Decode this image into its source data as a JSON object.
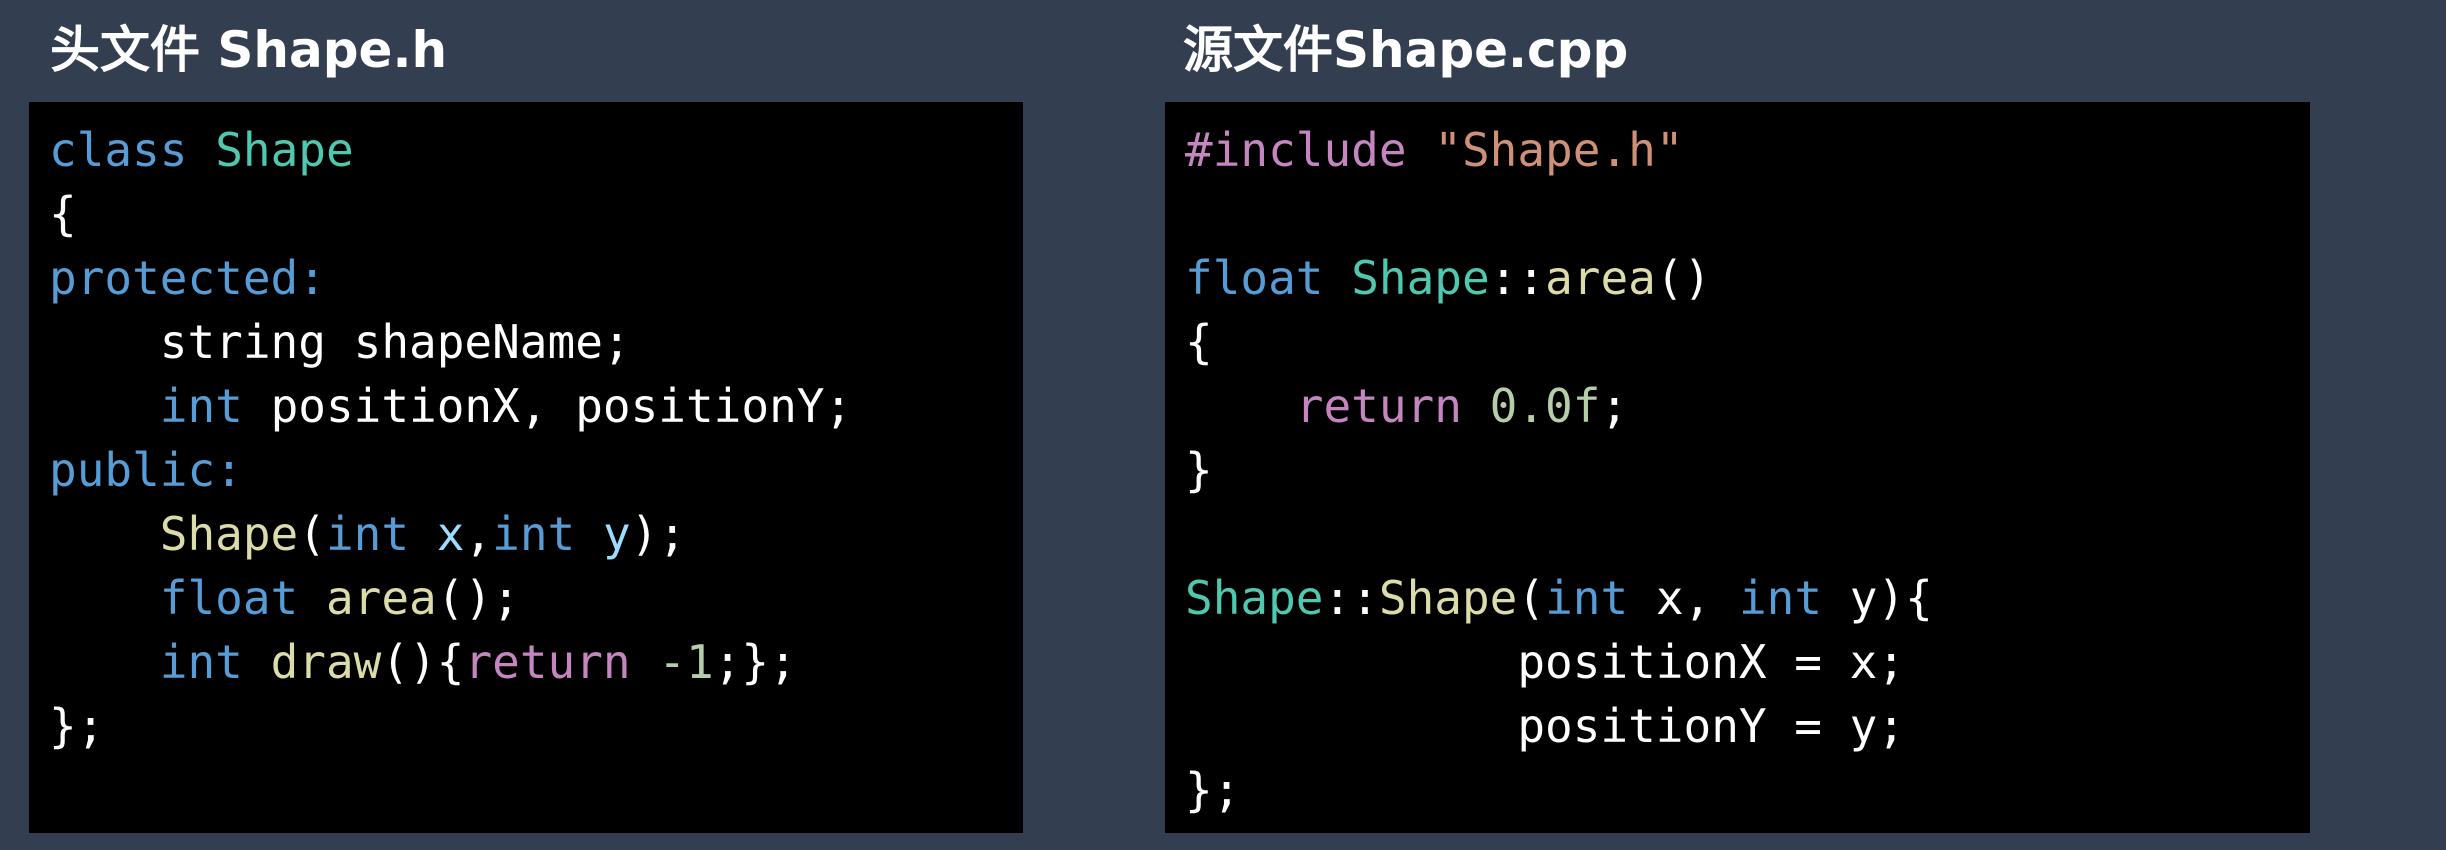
{
  "panels": [
    {
      "title": "头文件 Shape.h",
      "lines": [
        [
          [
            "kw",
            "class"
          ],
          [
            "pl",
            " "
          ],
          [
            "ty",
            "Shape"
          ]
        ],
        [
          [
            "pl",
            "{"
          ]
        ],
        [
          [
            "kw",
            "protected:"
          ]
        ],
        [
          [
            "pl",
            "    string shapeName;"
          ]
        ],
        [
          [
            "pl",
            "    "
          ],
          [
            "kw",
            "int"
          ],
          [
            "pl",
            " positionX, positionY;"
          ]
        ],
        [
          [
            "kw",
            "public:"
          ]
        ],
        [
          [
            "pl",
            "    "
          ],
          [
            "fn",
            "Shape"
          ],
          [
            "pl",
            "("
          ],
          [
            "kw",
            "int"
          ],
          [
            "pl",
            " "
          ],
          [
            "var",
            "x"
          ],
          [
            "pl",
            ","
          ],
          [
            "kw",
            "int"
          ],
          [
            "pl",
            " "
          ],
          [
            "var",
            "y"
          ],
          [
            "pl",
            ");"
          ]
        ],
        [
          [
            "pl",
            "    "
          ],
          [
            "kw",
            "float"
          ],
          [
            "pl",
            " "
          ],
          [
            "fn",
            "area"
          ],
          [
            "pl",
            "();"
          ]
        ],
        [
          [
            "pl",
            "    "
          ],
          [
            "kw",
            "int"
          ],
          [
            "pl",
            " "
          ],
          [
            "fn",
            "draw"
          ],
          [
            "pl",
            "(){"
          ],
          [
            "ct",
            "return"
          ],
          [
            "pl",
            " "
          ],
          [
            "num",
            "-1"
          ],
          [
            "pl",
            ";};"
          ]
        ],
        [
          [
            "pl",
            "};"
          ]
        ]
      ]
    },
    {
      "title": "源文件Shape.cpp",
      "lines": [
        [
          [
            "ct",
            "#include"
          ],
          [
            "pl",
            " "
          ],
          [
            "str",
            "\"Shape.h\""
          ]
        ],
        [
          [
            "pl",
            ""
          ]
        ],
        [
          [
            "kw",
            "float"
          ],
          [
            "pl",
            " "
          ],
          [
            "ty",
            "Shape"
          ],
          [
            "pl",
            "::"
          ],
          [
            "fn",
            "area"
          ],
          [
            "pl",
            "()"
          ]
        ],
        [
          [
            "pl",
            "{"
          ]
        ],
        [
          [
            "pl",
            "    "
          ],
          [
            "ct",
            "return"
          ],
          [
            "pl",
            " "
          ],
          [
            "num",
            "0.0f"
          ],
          [
            "pl",
            ";"
          ]
        ],
        [
          [
            "pl",
            "}"
          ]
        ],
        [
          [
            "pl",
            ""
          ]
        ],
        [
          [
            "ty",
            "Shape"
          ],
          [
            "pl",
            "::"
          ],
          [
            "fn",
            "Shape"
          ],
          [
            "pl",
            "("
          ],
          [
            "kw",
            "int"
          ],
          [
            "pl",
            " x, "
          ],
          [
            "kw",
            "int"
          ],
          [
            "pl",
            " y){"
          ]
        ],
        [
          [
            "pl",
            "            positionX = x;"
          ]
        ],
        [
          [
            "pl",
            "            positionY = y;"
          ]
        ],
        [
          [
            "pl",
            "};"
          ]
        ]
      ]
    }
  ]
}
